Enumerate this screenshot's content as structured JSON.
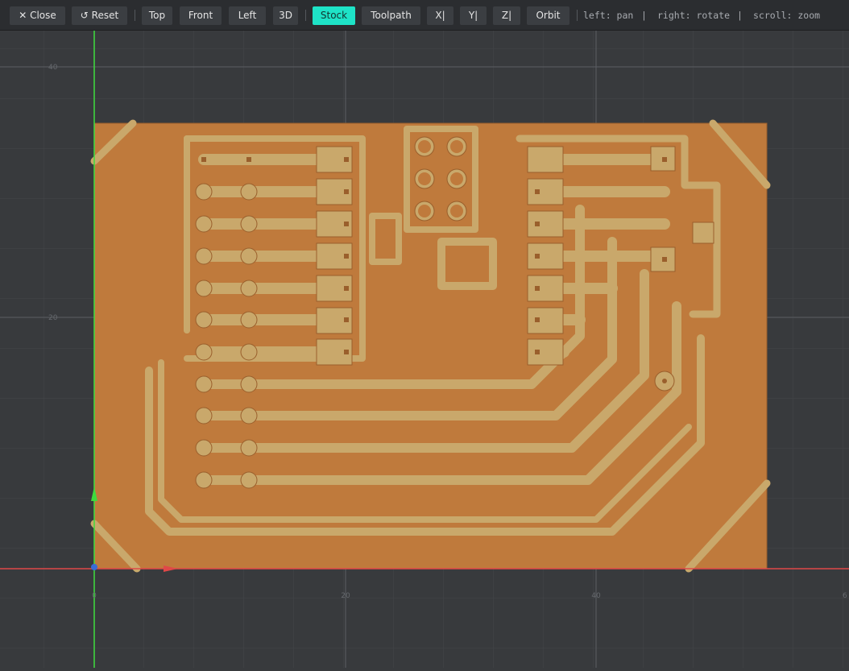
{
  "toolbar": {
    "close_label": "✕ Close",
    "reset_label": "↺ Reset",
    "views": [
      "Top",
      "Front",
      "Left",
      "3D"
    ],
    "layers": [
      "Stock",
      "Toolpath"
    ],
    "axis_buttons": [
      "X|",
      "Y|",
      "Z|"
    ],
    "orbit_label": "Orbit",
    "active_layer": "Stock",
    "hints": [
      "left: pan",
      "right: rotate",
      "scroll: zoom"
    ],
    "hint_separators": [
      "|",
      "|"
    ]
  },
  "grid": {
    "x_ticks": [
      "0",
      "20",
      "40",
      "6"
    ],
    "y_ticks": [
      "40",
      "20"
    ]
  },
  "colors": {
    "accent": "#1ee3c7",
    "stock": "#bf7a3c",
    "copper": "#c9a86b",
    "x_axis": "#e04848",
    "y_axis": "#3ddc3d",
    "z_axis": "#3a6bd6"
  }
}
